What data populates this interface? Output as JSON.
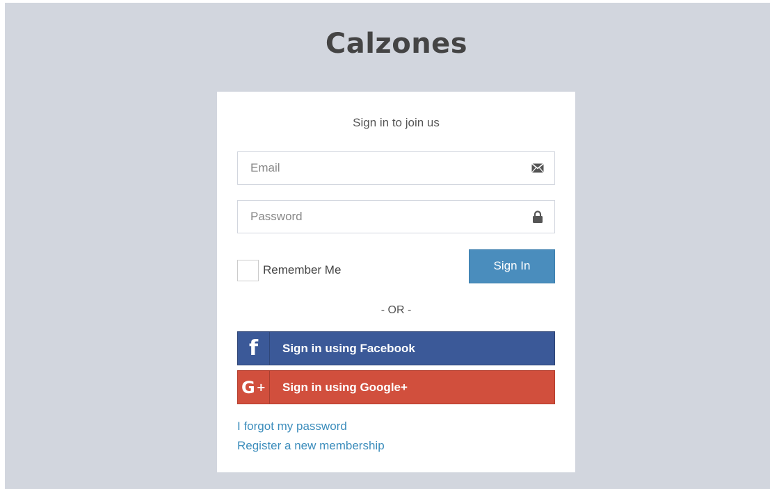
{
  "app": {
    "title": "Calzones"
  },
  "login": {
    "message": "Sign in to join us",
    "email_placeholder": "Email",
    "password_placeholder": "Password",
    "remember_label": "Remember Me",
    "remember_checked": false,
    "signin_label": "Sign In",
    "divider": "- OR -",
    "facebook_label": "Sign in using Facebook",
    "google_label": "Sign in using Google+",
    "forgot_link": "I forgot my password",
    "register_link": "Register a new membership"
  },
  "icons": {
    "email": "envelope-icon",
    "password": "lock-icon",
    "facebook": "facebook-icon",
    "google": "google-plus-icon"
  },
  "colors": {
    "background": "#d2d6de",
    "signin_button": "#4a8dbd",
    "facebook": "#3b5998",
    "google": "#d14f3d",
    "link": "#3c8dbc"
  }
}
